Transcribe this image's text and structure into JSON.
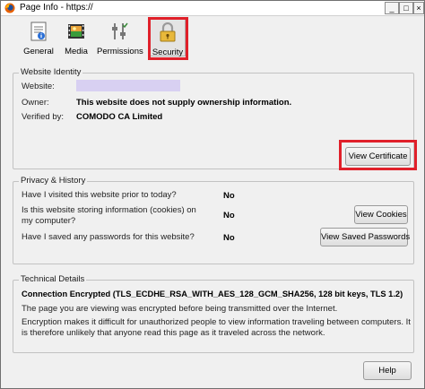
{
  "window": {
    "title": "Page Info - https://",
    "controls": [
      "_",
      "□",
      "×"
    ]
  },
  "toolbar": {
    "tabs": [
      {
        "label": "General",
        "icon": "info-page-icon"
      },
      {
        "label": "Media",
        "icon": "media-film-icon"
      },
      {
        "label": "Permissions",
        "icon": "permissions-sliders-icon"
      },
      {
        "label": "Security",
        "icon": "padlock-icon",
        "selected": true
      }
    ]
  },
  "identity": {
    "legend": "Website Identity",
    "website_label": "Website:",
    "website_value": "",
    "owner_label": "Owner:",
    "owner_value": "This website does not supply ownership information.",
    "verified_label": "Verified by:",
    "verified_value": "COMODO CA Limited",
    "view_certificate": "View Certificate"
  },
  "privacy": {
    "legend": "Privacy & History",
    "rows": [
      {
        "question": "Have I visited this website prior to today?",
        "answer": "No"
      },
      {
        "question": "Is this website storing information (cookies) on my computer?",
        "answer": "No"
      },
      {
        "question": "Have I saved any passwords for this website?",
        "answer": "No"
      }
    ],
    "view_cookies": "View Cookies",
    "view_saved_passwords": "View Saved Passwords"
  },
  "technical": {
    "legend": "Technical Details",
    "connection": "Connection Encrypted (TLS_ECDHE_RSA_WITH_AES_128_GCM_SHA256, 128 bit keys, TLS 1.2)",
    "line1": "The page you are viewing was encrypted before being transmitted over the Internet.",
    "line2": "Encryption makes it difficult for unauthorized people to view information traveling between computers. It is therefore unlikely that anyone read this page as it traveled across the network."
  },
  "footer": {
    "help": "Help"
  },
  "colors": {
    "highlight": "#e0202a",
    "website_value_fill": "#d8d0f2"
  }
}
